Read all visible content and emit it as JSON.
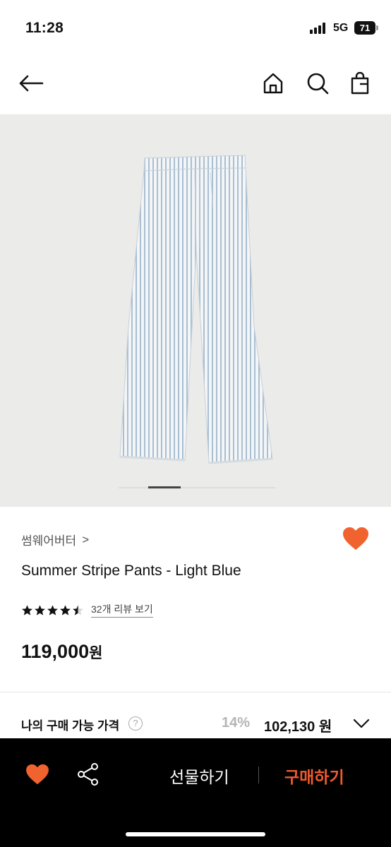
{
  "status_bar": {
    "time": "11:28",
    "network": "5G",
    "battery": "71"
  },
  "nav": {
    "back_icon": "arrow-left-icon",
    "home_icon": "home-icon",
    "search_icon": "search-icon",
    "bag_icon": "shopping-bag-icon"
  },
  "product": {
    "image_icon": "striped-pants-photo",
    "carousel_index": 2,
    "carousel_count": 5,
    "brand": "썸웨어버터",
    "brand_chevron": ">",
    "name": "Summer Stripe Pants - Light Blue",
    "rating": 4.5,
    "rating_max": 5,
    "review_link": "32개 리뷰 보기",
    "price": "119,000",
    "price_unit": "원",
    "liked": true
  },
  "my_price": {
    "label": "나의 구매 가능 가격",
    "help": "?",
    "discount": "14%",
    "value": "102,130 원"
  },
  "bottom_bar": {
    "gift_label": "선물하기",
    "buy_label": "구매하기"
  },
  "colors": {
    "accent": "#ef5b2d",
    "heart": "#f0632f",
    "bar_bg": "#000000"
  }
}
